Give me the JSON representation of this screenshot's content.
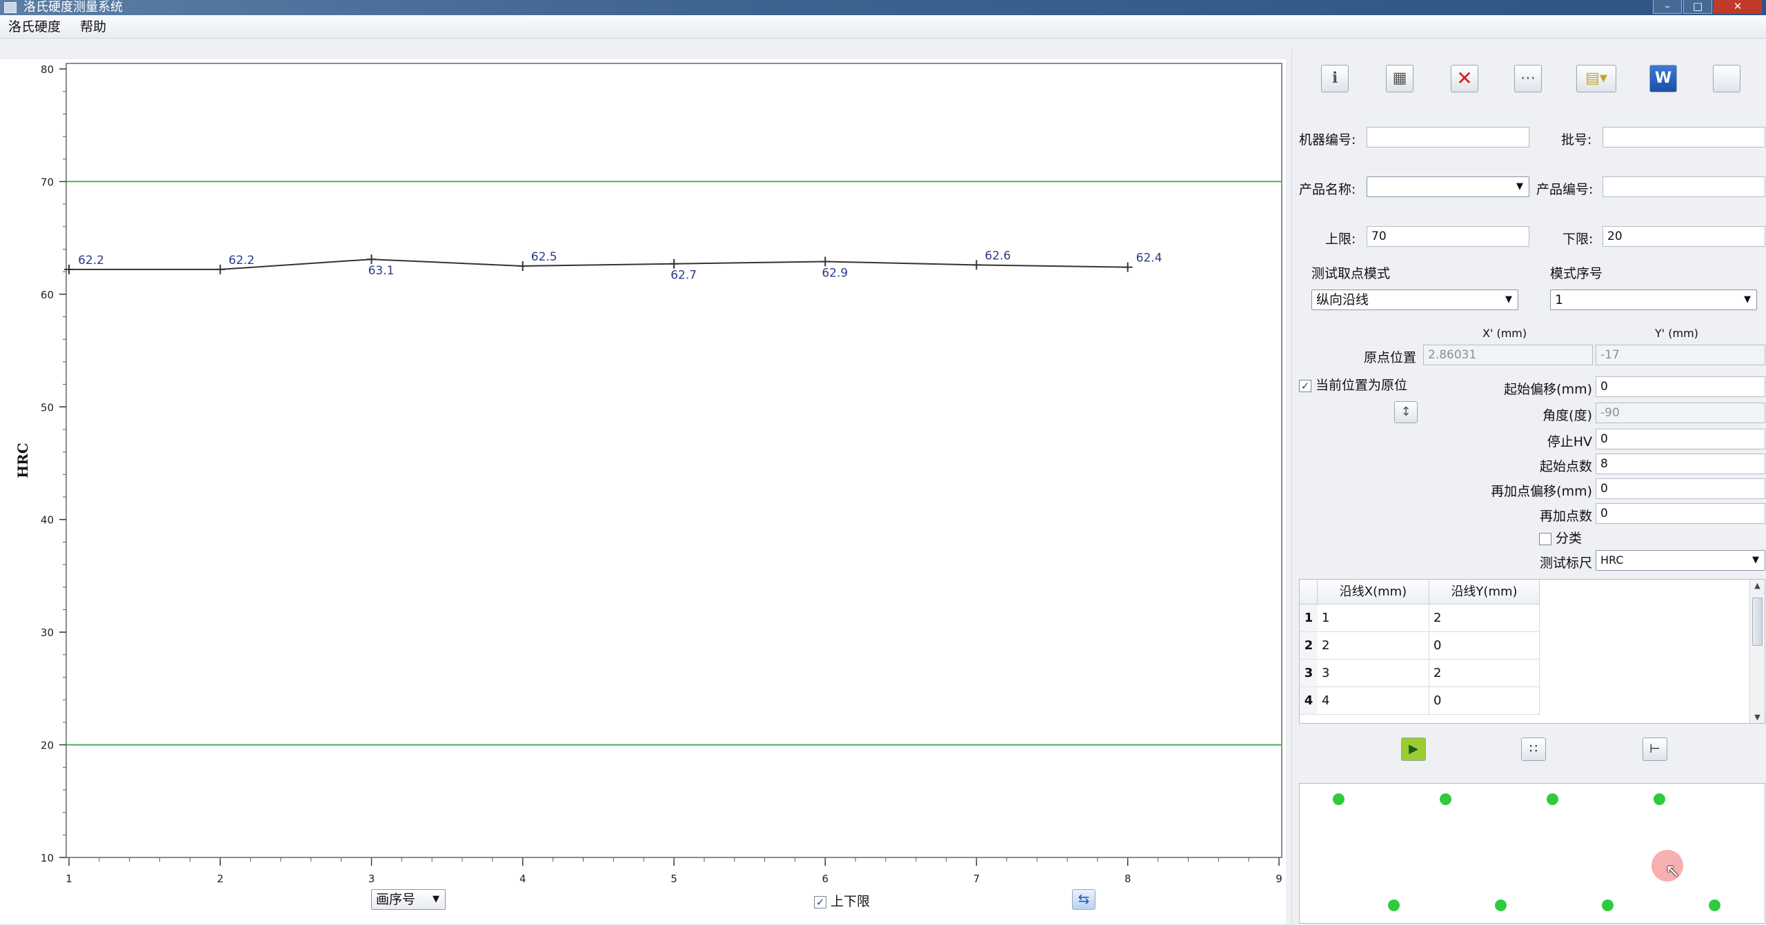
{
  "window": {
    "title": "洛氏硬度测量系统"
  },
  "menu": {
    "items": [
      "洛氏硬度",
      "帮助"
    ]
  },
  "chart_data": {
    "type": "line",
    "ylabel": "HRC",
    "ylim": [
      10,
      80
    ],
    "yticks": [
      10,
      20,
      30,
      40,
      50,
      60,
      70,
      80
    ],
    "xlim": [
      1,
      9
    ],
    "xticks": [
      1,
      2,
      3,
      4,
      5,
      6,
      7,
      8,
      9
    ],
    "x": [
      1,
      2,
      3,
      4,
      5,
      6,
      7,
      8
    ],
    "values": [
      62.2,
      62.2,
      63.1,
      62.5,
      62.7,
      62.9,
      62.6,
      62.4
    ],
    "labels": [
      "62.2",
      "62.2",
      "63.1",
      "62.5",
      "62.7",
      "62.9",
      "62.6",
      "62.4"
    ],
    "label_position": [
      "above",
      "above",
      "below",
      "above",
      "below",
      "below",
      "above",
      "above"
    ],
    "upper_limit": 70,
    "lower_limit": 20,
    "limit_color": "#4caf50",
    "line_color": "#333333",
    "label_color": "#2a3a8c",
    "grid": false
  },
  "chart_controls": {
    "x_axis_select": "画序号",
    "limits_checkbox": {
      "label": "上下限",
      "checked": true
    }
  },
  "toolbar": {
    "icons": [
      "info-icon",
      "grid-icon",
      "delete-icon",
      "scatter-icon",
      "open-folder-icon",
      "word-export-icon",
      "blank-page-icon"
    ]
  },
  "form": {
    "machine_no": {
      "label": "机器编号:",
      "value": ""
    },
    "batch_no": {
      "label": "批号:",
      "value": ""
    },
    "product_name": {
      "label": "产品名称:",
      "value": ""
    },
    "product_no": {
      "label": "产品编号:",
      "value": ""
    },
    "upper": {
      "label": "上限:",
      "value": "70"
    },
    "lower": {
      "label": "下限:",
      "value": "20"
    },
    "mode_group": {
      "title": "测试取点模式",
      "value": "纵向沿线"
    },
    "template_group": {
      "title": "模式序号",
      "value": "1"
    },
    "x_header": "X' (mm)",
    "y_header": "Y' (mm)",
    "origin": {
      "label": "原点位置",
      "x": "2.86031",
      "y": "-17"
    },
    "use_current": {
      "label": "当前位置为原位",
      "checked": true
    },
    "start_offset": {
      "label": "起始偏移(mm)",
      "value": "0"
    },
    "angle": {
      "label": "角度(度)",
      "value": "-90"
    },
    "stop_hv": {
      "label": "停止HV",
      "value": "0"
    },
    "start_points": {
      "label": "起始点数",
      "value": "8"
    },
    "extra_offset": {
      "label": "再加点偏移(mm)",
      "value": "0"
    },
    "extra_points": {
      "label": "再加点数",
      "value": "0"
    },
    "classify": {
      "label": "分类",
      "checked": false
    },
    "scale": {
      "label": "测试标尺",
      "value": "HRC"
    }
  },
  "table": {
    "columns": [
      "沿线X(mm)",
      "沿线Y(mm)"
    ],
    "rows": [
      {
        "num": "1",
        "x": "1",
        "y": "2"
      },
      {
        "num": "2",
        "x": "2",
        "y": "0"
      },
      {
        "num": "3",
        "x": "3",
        "y": "2"
      },
      {
        "num": "4",
        "x": "4",
        "y": "0"
      }
    ]
  },
  "actions": {
    "icons": [
      "play-icon",
      "dots-icon",
      "align-icon"
    ],
    "play_color": "#9acd32"
  },
  "preview": {
    "dot_color": "#2fcb3e",
    "point_count": 8
  }
}
